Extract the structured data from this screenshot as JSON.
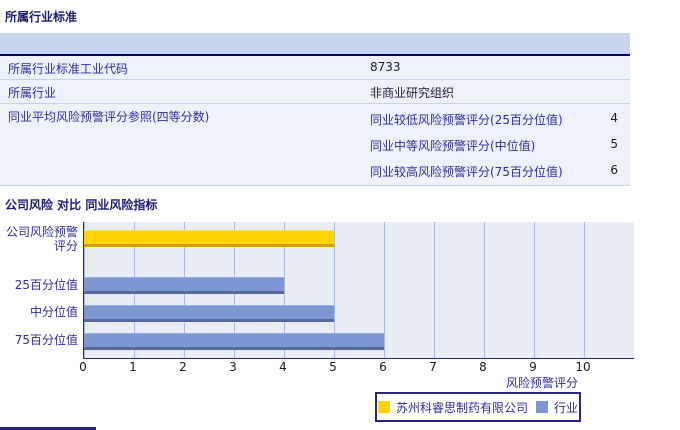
{
  "industry_section": {
    "title": "所属行业标准",
    "rows": [
      {
        "label": "所属行业标准工业代码",
        "value": "8733"
      },
      {
        "label": "所属行业",
        "value": "非商业研究组织"
      }
    ],
    "group": {
      "label": "同业平均风险预警评分参照(四等分数)",
      "items": [
        {
          "label": "同业较低风险预警评分(25百分位值)",
          "value": "4"
        },
        {
          "label": "同业中等风险预警评分(中位值)",
          "value": "5"
        },
        {
          "label": "同业较高风险预警评分(75百分位值)",
          "value": "6"
        }
      ]
    }
  },
  "comparison_section": {
    "title": "公司风险 对比 同业风险指标"
  },
  "chart_data": {
    "type": "bar",
    "orientation": "horizontal",
    "categories": [
      "公司风险预警评分",
      "25百分位值",
      "中分位值",
      "75百分位值"
    ],
    "values": [
      5,
      4,
      5,
      6
    ],
    "bar_series": [
      "company",
      "industry",
      "industry",
      "industry"
    ],
    "series_colors": {
      "company": "#ffd400",
      "industry": "#7e97d3"
    },
    "xlabel": "风险预警评分",
    "x_ticks": [
      0,
      1,
      2,
      3,
      4,
      5,
      6,
      7,
      8,
      9,
      10
    ],
    "xlim": [
      0,
      11
    ],
    "grid": true,
    "legend_position": "bottom",
    "legend": [
      {
        "label": "苏州科睿思制药有限公司",
        "series": "company",
        "color": "#ffd400"
      },
      {
        "label": "行业",
        "series": "industry",
        "color": "#7e97d3"
      }
    ]
  },
  "theme": {
    "header_bar_bg": "#c7d5ee",
    "header_bar_border": "#000066",
    "row_bg": "#edf1f9",
    "label_text": "#2e2e9e",
    "title_text": "#1b1b74",
    "plot_bg": "#e9edf5",
    "gridline": "#a9b9e1"
  }
}
